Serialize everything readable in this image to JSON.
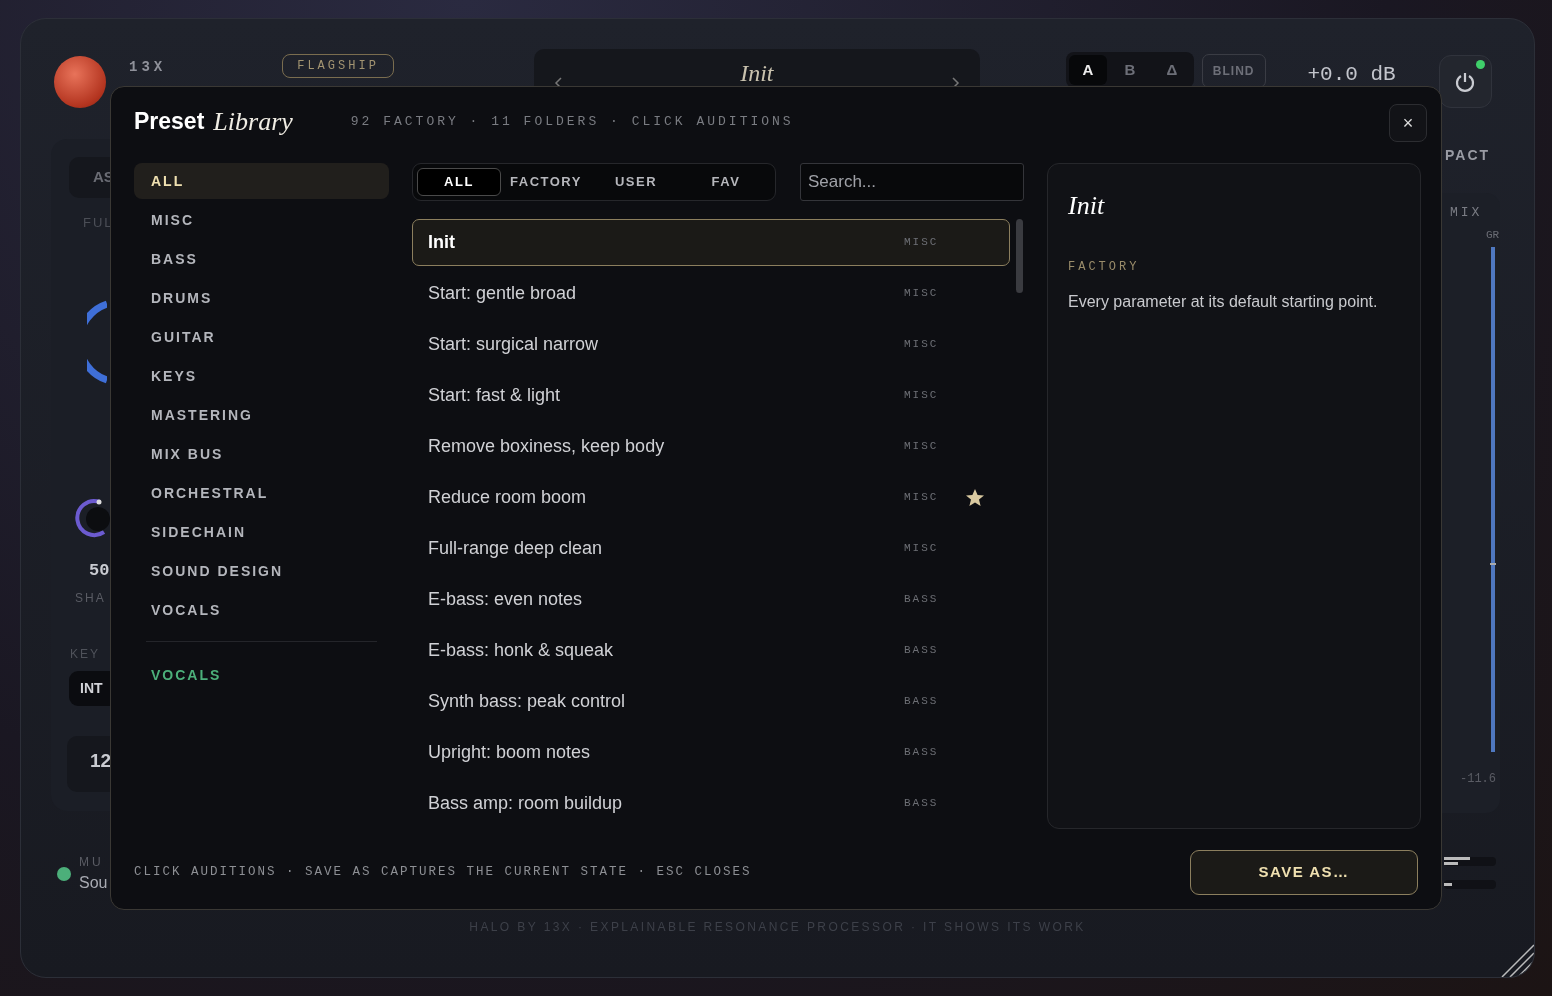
{
  "plugin": {
    "brand": "13X",
    "badge": "FLAGSHIP",
    "preset_name": "Init",
    "ab_buttons": [
      {
        "label": "A",
        "selected": true
      },
      {
        "label": "B",
        "selected": false
      },
      {
        "label": "Δ",
        "selected": false
      }
    ],
    "blind": "BLIND",
    "output_gain": "+0.0 dB",
    "power": {
      "on": true
    },
    "left_panel": {
      "mode_tab": "AS",
      "band_label": "FUL",
      "knob_value": "50",
      "knob_label": "SHA",
      "key_label": "KEY",
      "key_option": "INT",
      "threshold": "12"
    },
    "status": {
      "label": "MU",
      "text": "Sou",
      "color": "#4caf7a"
    },
    "right_panel": {
      "tab": "PACT",
      "mix_label": "MIX",
      "gr_label": "GR",
      "gr_reading": "-11.6"
    },
    "footer": "HALO BY 13X · EXPLAINABLE RESONANCE PROCESSOR · IT SHOWS ITS WORK"
  },
  "library": {
    "title": "Preset",
    "title_emphasis": "Library",
    "summary": "92 FACTORY · 11 FOLDERS · CLICK AUDITIONS",
    "close": "×",
    "folders": [
      {
        "label": "ALL",
        "selected": true
      },
      {
        "label": "MISC",
        "selected": false
      },
      {
        "label": "BASS",
        "selected": false
      },
      {
        "label": "DRUMS",
        "selected": false
      },
      {
        "label": "GUITAR",
        "selected": false
      },
      {
        "label": "KEYS",
        "selected": false
      },
      {
        "label": "MASTERING",
        "selected": false
      },
      {
        "label": "MIX BUS",
        "selected": false
      },
      {
        "label": "ORCHESTRAL",
        "selected": false
      },
      {
        "label": "SIDECHAIN",
        "selected": false
      },
      {
        "label": "SOUND DESIGN",
        "selected": false
      },
      {
        "label": "VOCALS",
        "selected": false
      }
    ],
    "user_folders": [
      {
        "label": "VOCALS",
        "selected": false,
        "color": "#4caf7a"
      }
    ],
    "filters": [
      {
        "label": "ALL",
        "selected": true
      },
      {
        "label": "FACTORY",
        "selected": false
      },
      {
        "label": "USER",
        "selected": false
      },
      {
        "label": "FAV",
        "selected": false
      }
    ],
    "search": {
      "placeholder": "Search..."
    },
    "presets": [
      {
        "name": "Init",
        "tag": "MISC",
        "favorite": false,
        "selected": true
      },
      {
        "name": "Start: gentle broad",
        "tag": "MISC",
        "favorite": false,
        "selected": false
      },
      {
        "name": "Start: surgical narrow",
        "tag": "MISC",
        "favorite": false,
        "selected": false
      },
      {
        "name": "Start: fast & light",
        "tag": "MISC",
        "favorite": false,
        "selected": false
      },
      {
        "name": "Remove boxiness, keep body",
        "tag": "MISC",
        "favorite": false,
        "selected": false
      },
      {
        "name": "Reduce room boom",
        "tag": "MISC",
        "favorite": true,
        "selected": false
      },
      {
        "name": "Full-range deep clean",
        "tag": "MISC",
        "favorite": false,
        "selected": false
      },
      {
        "name": "E-bass: even notes",
        "tag": "BASS",
        "favorite": false,
        "selected": false
      },
      {
        "name": "E-bass: honk & squeak",
        "tag": "BASS",
        "favorite": false,
        "selected": false
      },
      {
        "name": "Synth bass: peak control",
        "tag": "BASS",
        "favorite": false,
        "selected": false
      },
      {
        "name": "Upright: boom notes",
        "tag": "BASS",
        "favorite": false,
        "selected": false
      },
      {
        "name": "Bass amp: room buildup",
        "tag": "BASS",
        "favorite": false,
        "selected": false
      }
    ],
    "detail": {
      "name": "Init",
      "source": "FACTORY",
      "description": "Every parameter at its default starting point."
    },
    "hint": "CLICK AUDITIONS · SAVE AS CAPTURES THE CURRENT STATE · ESC CLOSES",
    "save_button": "SAVE AS…"
  }
}
